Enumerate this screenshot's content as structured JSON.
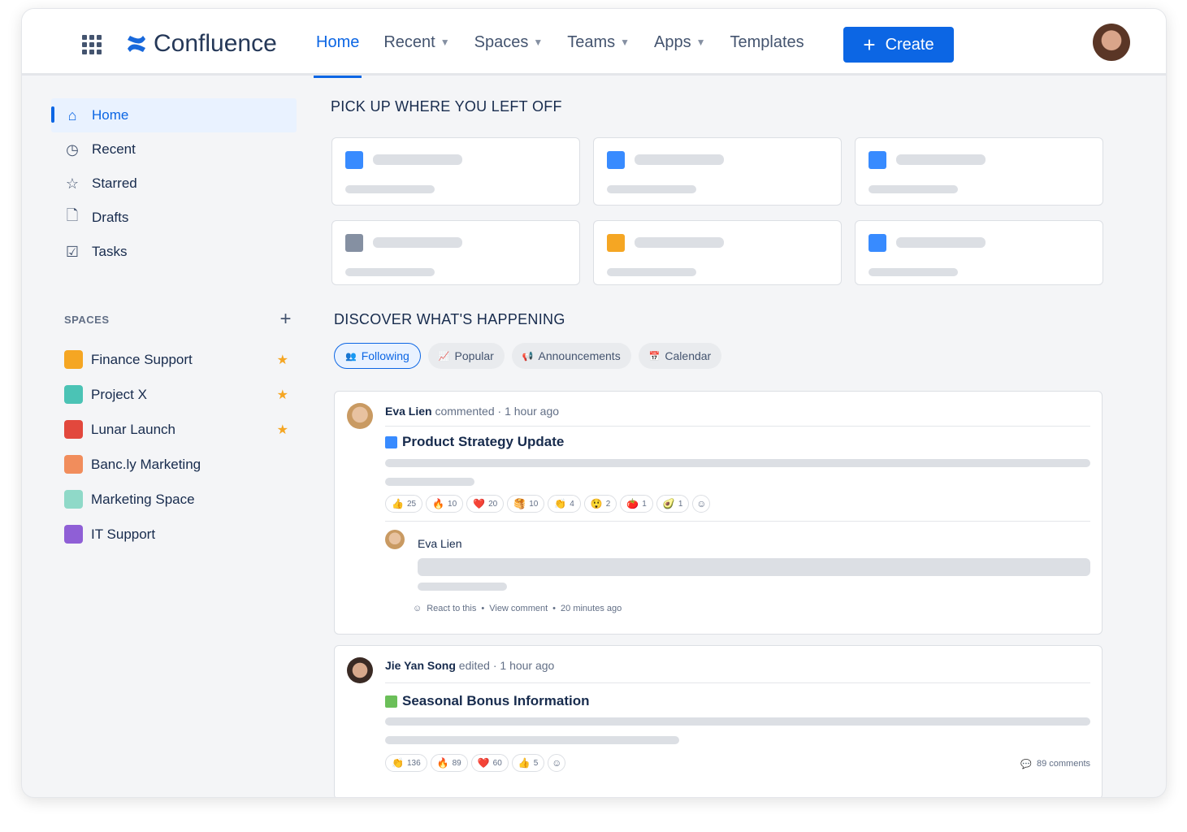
{
  "header": {
    "brand": "Confluence",
    "nav": [
      {
        "label": "Home",
        "active": true
      },
      {
        "label": "Recent",
        "dropdown": true
      },
      {
        "label": "Spaces",
        "dropdown": true
      },
      {
        "label": "Teams",
        "dropdown": true
      },
      {
        "label": "Apps",
        "dropdown": true
      },
      {
        "label": "Templates"
      }
    ],
    "create": "Create"
  },
  "sidebar": {
    "items": [
      {
        "label": "Home",
        "icon": "home-icon"
      },
      {
        "label": "Recent",
        "icon": "clock-icon"
      },
      {
        "label": "Starred",
        "icon": "star-icon"
      },
      {
        "label": "Drafts",
        "icon": "draft-icon"
      },
      {
        "label": "Tasks",
        "icon": "task-icon"
      }
    ],
    "spaces_heading": "SPACES",
    "spaces": [
      {
        "label": "Finance Support",
        "color": "#f5a623",
        "starred": true
      },
      {
        "label": "Project X",
        "color": "#4bc3b5",
        "starred": true
      },
      {
        "label": "Lunar Launch",
        "color": "#e2483d",
        "starred": true
      },
      {
        "label": "Banc.ly Marketing",
        "color": "#f18d5c",
        "starred": false
      },
      {
        "label": "Marketing Space",
        "color": "#8fd9c8",
        "starred": false
      },
      {
        "label": "IT Support",
        "color": "#8f5fd6",
        "starred": false
      }
    ]
  },
  "pickup": {
    "heading": "PICK UP WHERE YOU LEFT OFF"
  },
  "discover": {
    "heading": "DISCOVER WHAT'S HAPPENING",
    "tabs": [
      {
        "label": "Following",
        "active": true
      },
      {
        "label": "Popular"
      },
      {
        "label": "Announcements"
      },
      {
        "label": "Calendar"
      }
    ]
  },
  "feed": [
    {
      "user": "Eva Lien",
      "action": "commented",
      "time": "1 hour ago",
      "title": "Product Strategy Update",
      "reactions": [
        {
          "e": "👍",
          "n": "25"
        },
        {
          "e": "🔥",
          "n": "10"
        },
        {
          "e": "❤️",
          "n": "20"
        },
        {
          "e": "🥞",
          "n": "10"
        },
        {
          "e": "👏",
          "n": "4"
        },
        {
          "e": "😲",
          "n": "2"
        },
        {
          "e": "🍅",
          "n": "1"
        },
        {
          "e": "🥑",
          "n": "1"
        }
      ],
      "comment": {
        "user": "Eva Lien",
        "react": "React to this",
        "view": "View comment",
        "time": "20 minutes ago"
      }
    },
    {
      "user": "Jie Yan Song",
      "action": "edited",
      "time": "1 hour ago",
      "title": "Seasonal Bonus Information",
      "reactions": [
        {
          "e": "👏",
          "n": "136"
        },
        {
          "e": "🔥",
          "n": "89"
        },
        {
          "e": "❤️",
          "n": "60"
        },
        {
          "e": "👍",
          "n": "5"
        }
      ],
      "comments": "89 comments"
    }
  ]
}
